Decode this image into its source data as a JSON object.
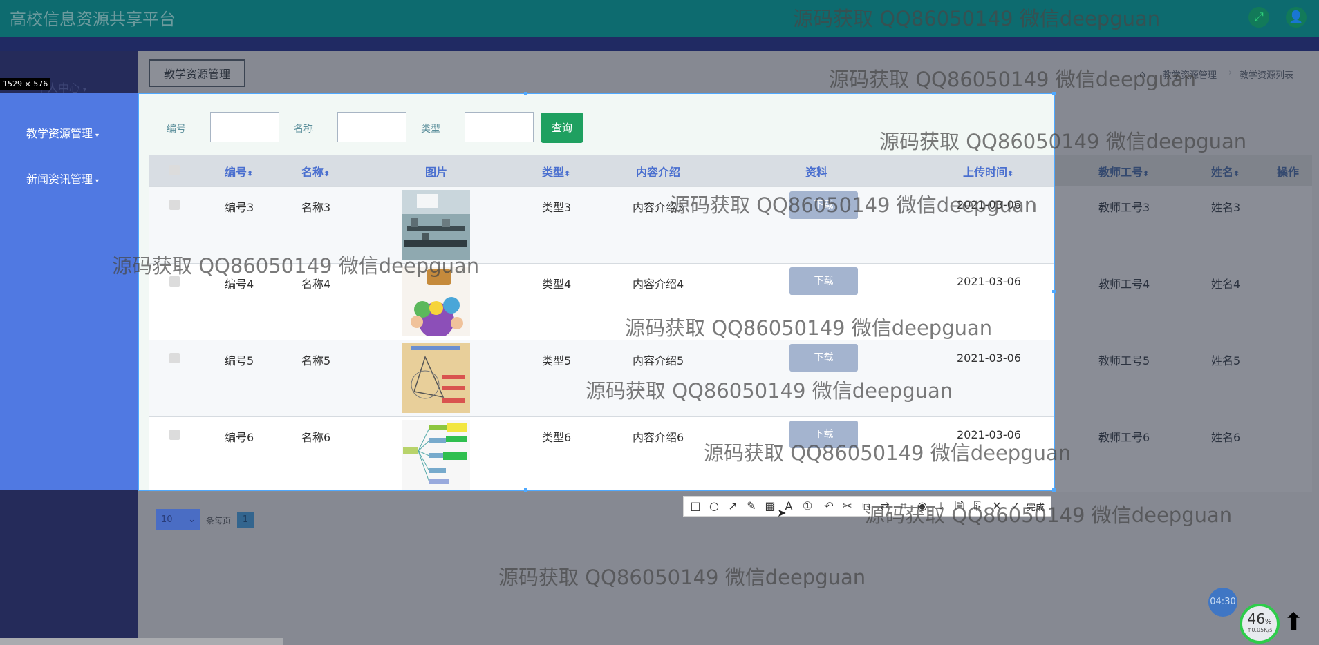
{
  "header": {
    "title": "高校信息资源共享平台",
    "icons": [
      "fullscreen-icon",
      "user-icon"
    ]
  },
  "sidebar": {
    "user_center": "个人中心",
    "items": [
      {
        "label": "教学资源管理",
        "icon": "caret-down-icon"
      },
      {
        "label": "新闻资讯管理",
        "icon": "caret-down-icon"
      }
    ]
  },
  "dimension_label": "1529 × 576",
  "tab": {
    "label": "教学资源管理"
  },
  "breadcrumb": {
    "home_icon": "home-icon",
    "items": [
      "教学资源管理",
      "教学资源列表"
    ]
  },
  "search": {
    "fields": [
      {
        "label": "编号",
        "value": ""
      },
      {
        "label": "名称",
        "value": ""
      },
      {
        "label": "类型",
        "value": ""
      }
    ],
    "button": "查询"
  },
  "table": {
    "headers": [
      "编号",
      "名称",
      "图片",
      "类型",
      "内容介绍",
      "资料",
      "上传时间",
      "教师工号",
      "姓名",
      "操作"
    ],
    "sort_icon": "sort-icon",
    "rows": [
      {
        "id": "编号3",
        "name": "名称3",
        "type": "类型3",
        "intro": "内容介绍3",
        "file": "下载",
        "time": "2021-03-06",
        "teacher_no": "教师工号3",
        "teacher_name": "姓名3"
      },
      {
        "id": "编号4",
        "name": "名称4",
        "type": "类型4",
        "intro": "内容介绍4",
        "file": "下载",
        "time": "2021-03-06",
        "teacher_no": "教师工号4",
        "teacher_name": "姓名4"
      },
      {
        "id": "编号5",
        "name": "名称5",
        "type": "类型5",
        "intro": "内容介绍5",
        "file": "下载",
        "time": "2021-03-06",
        "teacher_no": "教师工号5",
        "teacher_name": "姓名5"
      },
      {
        "id": "编号6",
        "name": "名称6",
        "type": "类型6",
        "intro": "内容介绍6",
        "file": "下载",
        "time": "2021-03-06",
        "teacher_no": "教师工号6",
        "teacher_name": "姓名6"
      }
    ]
  },
  "pagination": {
    "page_size": "10",
    "per_page_label": "条每页",
    "current_page": "1"
  },
  "toolbar": {
    "tools": [
      "rectangle-icon",
      "ellipse-icon",
      "arrow-icon",
      "pencil-icon",
      "mosaic-icon",
      "text-icon",
      "number-icon",
      "undo-icon",
      "scissors-icon",
      "pin-icon",
      "translate-icon",
      "ocr-icon",
      "record-icon",
      "download-icon",
      "save-icon",
      "copy-icon",
      "close-icon",
      "check-icon"
    ],
    "done_label": "完成"
  },
  "watermark": "源码获取 QQ86050149 微信deepguan",
  "widgets": {
    "clock": "04:30",
    "gauge_percent": "46",
    "gauge_percent_unit": "%",
    "net_speed": "↑0.05K/s"
  },
  "colors": {
    "header": "#0d6b6f",
    "sidebar_active": "#5079e2",
    "query_button": "#1fa060",
    "header_text": "#4a6fcf"
  }
}
